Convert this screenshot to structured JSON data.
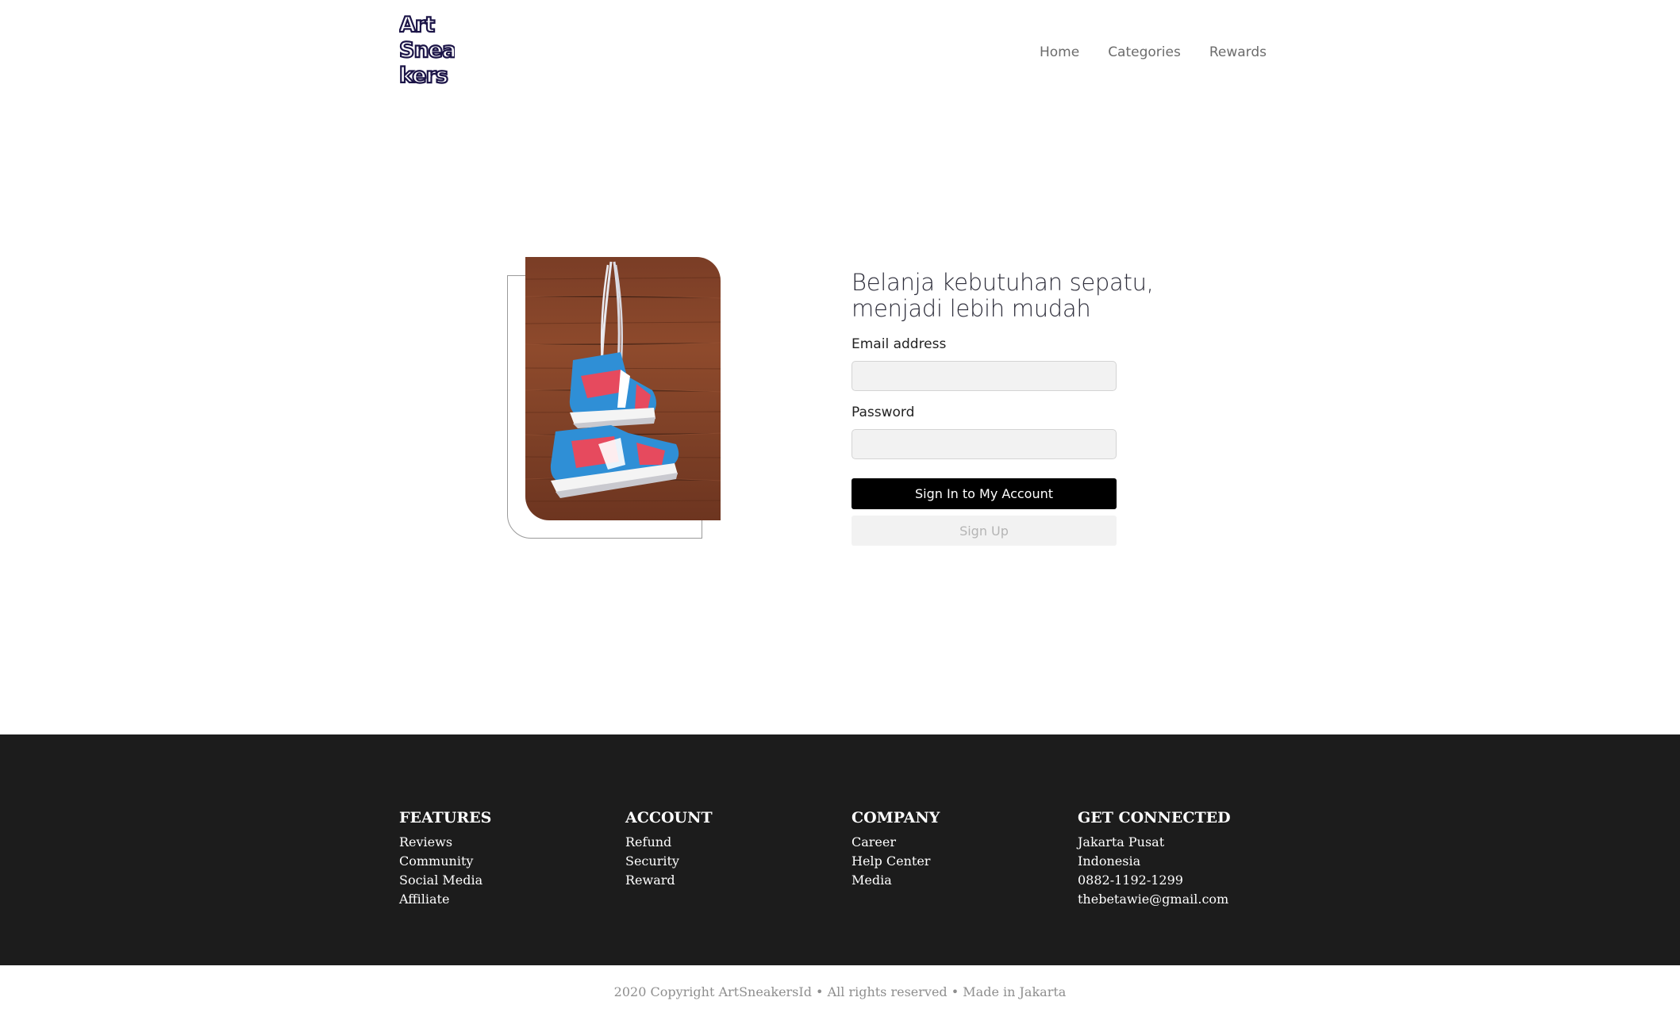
{
  "brand": {
    "logo_lines": [
      "Art",
      "Snea",
      "kers"
    ],
    "colors": {
      "accent": "#000000",
      "footer_bg": "#1c1c1c",
      "logo_outline": "#1b1447"
    }
  },
  "nav": {
    "items": [
      {
        "label": "Home"
      },
      {
        "label": "Categories"
      },
      {
        "label": "Rewards"
      }
    ]
  },
  "hero": {
    "image_icon": "hanging-sneakers-photo",
    "heading_lines": [
      "Belanja kebutuhan sepatu,",
      "menjadi lebih mudah"
    ]
  },
  "form": {
    "email_label": "Email address",
    "email_value": "",
    "password_label": "Password",
    "password_value": "",
    "signin_label": "Sign In to My Account",
    "signup_label": "Sign Up"
  },
  "footer": {
    "columns": [
      {
        "title": "FEATURES",
        "items": [
          "Reviews",
          "Community",
          "Social Media",
          "Affiliate"
        ]
      },
      {
        "title": "ACCOUNT",
        "items": [
          "Refund",
          "Security",
          "Reward"
        ]
      },
      {
        "title": "COMPANY",
        "items": [
          "Career",
          "Help Center",
          "Media"
        ]
      },
      {
        "title": "GET CONNECTED",
        "items": [
          "Jakarta Pusat",
          "Indonesia",
          "0882-1192-1299",
          "thebetawie@gmail.com"
        ]
      }
    ],
    "copyright": "2020 Copyright ArtSneakersId • All rights reserved • Made in Jakarta"
  }
}
